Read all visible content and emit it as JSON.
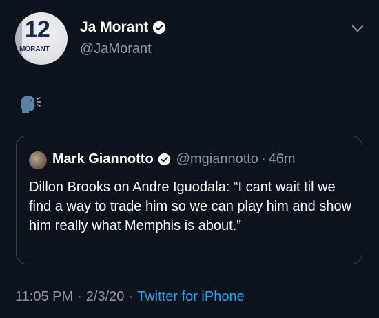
{
  "author": {
    "display_name": "Ja Morant",
    "handle": "@JaMorant",
    "avatar_number": "12",
    "avatar_name": "MORANT",
    "verified": true
  },
  "tweet": {
    "body_icon": "speaking-head-icon"
  },
  "quoted_tweet": {
    "display_name": "Mark Giannotto",
    "handle": "@mgiannotto",
    "separator": "·",
    "time_ago": "46m",
    "verified": true,
    "text": "Dillon Brooks on Andre Iguodala: “I cant wait til we find a way to trade him so we can play him and show him really what Memphis is about.”"
  },
  "meta": {
    "time": "11:05 PM",
    "date": "2/3/20",
    "separator": "·",
    "source": "Twitter for iPhone"
  },
  "colors": {
    "background": "#0d131c",
    "secondary_text": "#8899a6",
    "accent": "#1da1f2",
    "border": "#38444d"
  }
}
